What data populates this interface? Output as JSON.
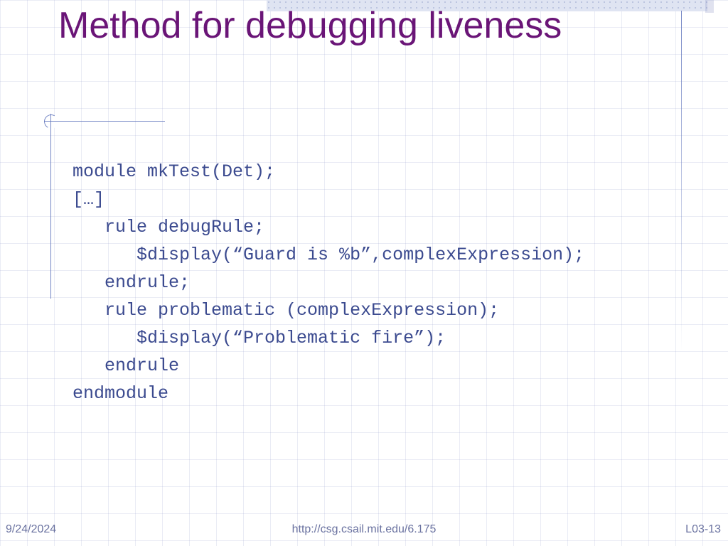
{
  "title": "Method for debugging liveness",
  "code_lines": [
    "module mkTest(Det);",
    "[…]",
    "   rule debugRule;",
    "      $display(“Guard is %b”,complexExpression);",
    "   endrule;",
    "   rule problematic (complexExpression);",
    "      $display(“Problematic fire”);",
    "   endrule",
    "endmodule"
  ],
  "footer": {
    "date": "9/24/2024",
    "url": "http://csg.csail.mit.edu/6.175",
    "page": "L03-13"
  }
}
